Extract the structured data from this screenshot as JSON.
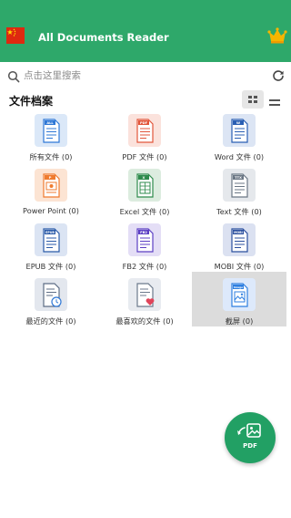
{
  "app": {
    "title": "All Documents Reader",
    "flag_icon": "china-flag-icon",
    "premium_icon": "crown-icon",
    "brand_color": "#2ea86a"
  },
  "search": {
    "placeholder": "点击这里搜索",
    "icon": "search-icon",
    "refresh_icon": "refresh-icon"
  },
  "section": {
    "title": "文件档案",
    "view_modes": [
      "grid-view-icon",
      "list-view-icon"
    ],
    "active_view": "grid"
  },
  "categories": [
    {
      "label": "所有文件 (0)",
      "badge": "ALL",
      "color": "#2f78d6",
      "bg": "#dbe8f8"
    },
    {
      "label": "PDF 文件 (0)",
      "badge": "PDF",
      "color": "#e2563b",
      "bg": "#fbe2dc"
    },
    {
      "label": "Word 文件 (0)",
      "badge": "W",
      "color": "#2a5fb3",
      "bg": "#dce5f4"
    },
    {
      "label": "Power Point (0)",
      "badge": "P",
      "color": "#ef7b2f",
      "bg": "#fce4d3"
    },
    {
      "label": "Excel 文件 (0)",
      "badge": "X",
      "color": "#2e8b4c",
      "bg": "#dcecdf"
    },
    {
      "label": "Text 文件 (0)",
      "badge": "TTX",
      "color": "#6b7785",
      "bg": "#e5e8ec"
    },
    {
      "label": "EPUB 文件 (0)",
      "badge": "EPUB",
      "color": "#2a5aa8",
      "bg": "#dbe4f3"
    },
    {
      "label": "FB2 文件 (0)",
      "badge": "FB2",
      "color": "#5c3fc4",
      "bg": "#e4def6"
    },
    {
      "label": "MOBI 文件 (0)",
      "badge": "MOBI",
      "color": "#2b4f9e",
      "bg": "#dbe1f1"
    },
    {
      "label": "最近的文件 (0)",
      "badge": "",
      "color": "#5e6e86",
      "bg": "#e3e7ee"
    },
    {
      "label": "最喜欢的文件 (0)",
      "badge": "",
      "color": "#6c7a8c",
      "bg": "#e8ebf0"
    },
    {
      "label": "截屏 (0)",
      "badge": "Image",
      "color": "#2f7fe0",
      "bg": "#dde9fb"
    }
  ],
  "selected_category": "截屏 (0)",
  "fab": {
    "label": "PDF",
    "icon": "image-to-pdf-icon",
    "color": "#22a064"
  }
}
